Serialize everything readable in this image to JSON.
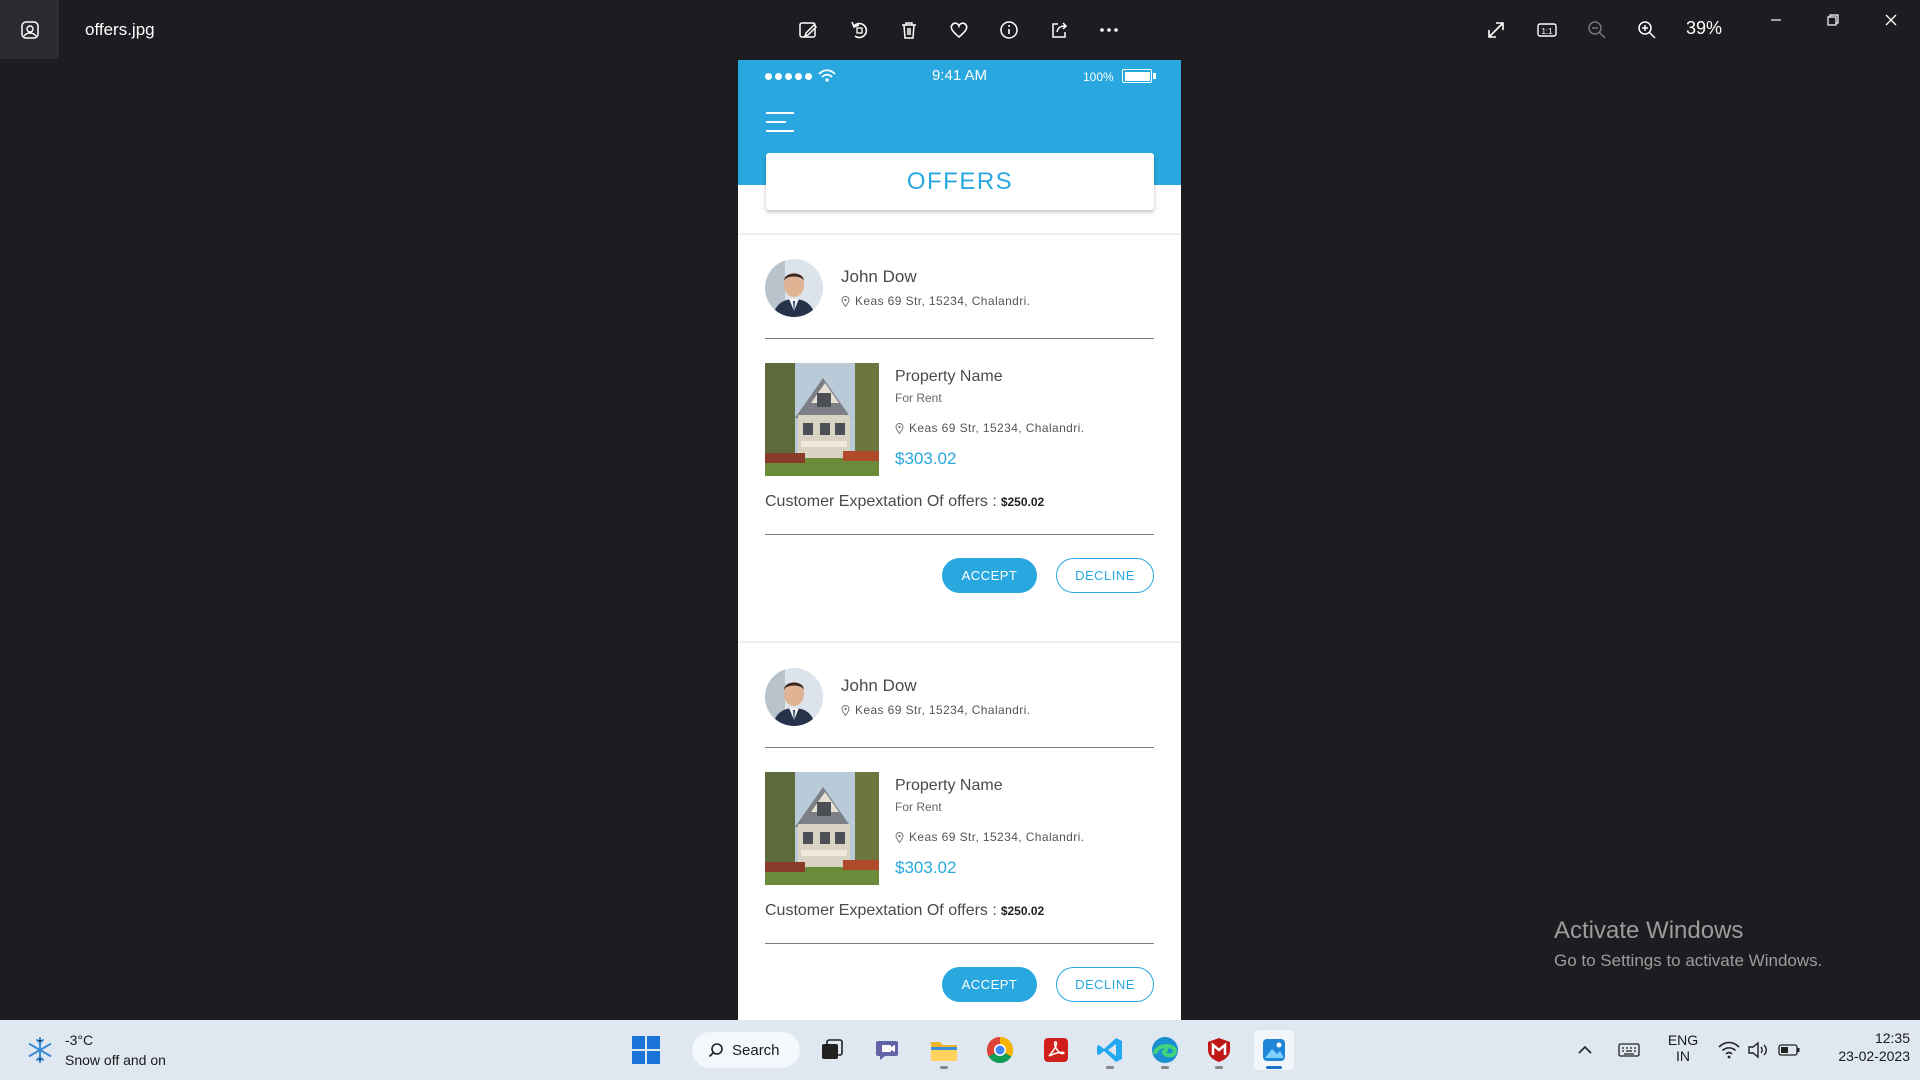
{
  "window": {
    "filename": "offers.jpg",
    "zoom_level": "39%"
  },
  "toolbar": {
    "actions": [
      "edit-image-icon",
      "rotate-icon",
      "delete-icon",
      "favorite-icon",
      "info-icon",
      "share-icon",
      "more-icon"
    ],
    "right": [
      "fullscreen-icon",
      "actual-size-icon",
      "zoom-out-icon",
      "zoom-in-icon"
    ]
  },
  "phone": {
    "status": {
      "time": "9:41 AM",
      "battery": "100%"
    },
    "header_title": "OFFERS",
    "offers": [
      {
        "person_name": "John Dow",
        "person_address": "Keas 69 Str, 15234, Chalandri.",
        "property_name": "Property Name",
        "property_type": "For Rent",
        "property_address": "Keas 69 Str, 15234, Chalandri.",
        "price": "$303.02",
        "expectation_label": "Customer Expextation Of offers :",
        "expectation_value": "$250.02",
        "accept_label": "ACCEPT",
        "decline_label": "DECLINE"
      },
      {
        "person_name": "John Dow",
        "person_address": "Keas 69 Str, 15234, Chalandri.",
        "property_name": "Property Name",
        "property_type": "For Rent",
        "property_address": "Keas 69 Str, 15234, Chalandri.",
        "price": "$303.02",
        "expectation_label": "Customer Expextation Of offers :",
        "expectation_value": "$250.02",
        "accept_label": "ACCEPT",
        "decline_label": "DECLINE"
      }
    ]
  },
  "watermark": {
    "title": "Activate Windows",
    "subtitle": "Go to Settings to activate Windows."
  },
  "taskbar": {
    "weather_temp": "-3°C",
    "weather_desc": "Snow off and on",
    "search_label": "Search",
    "lang_line1": "ENG",
    "lang_line2": "IN",
    "clock_time": "12:35",
    "clock_date": "23-02-2023"
  },
  "colors": {
    "accent": "#29a8df",
    "background": "#1c1d20",
    "taskbar": "#dfe7f1"
  }
}
